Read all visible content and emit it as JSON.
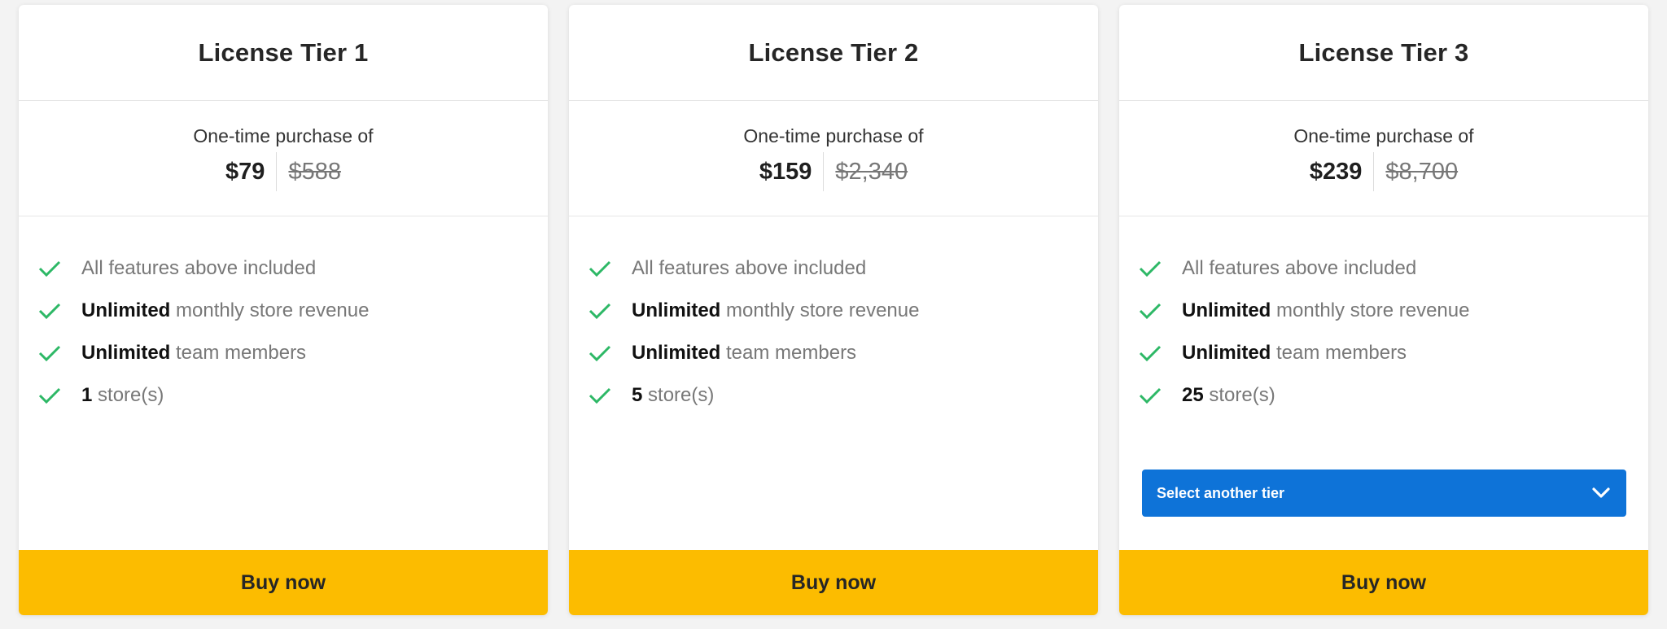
{
  "colors": {
    "accent_blue": "#0e73d8",
    "buy_yellow": "#fcbc00",
    "check_green": "#2db866"
  },
  "tiers": [
    {
      "title": "License Tier 1",
      "price_label": "One-time purchase of",
      "price_now": "$79",
      "price_old": "$588",
      "features": [
        {
          "bold": "",
          "text": "All features above included"
        },
        {
          "bold": "Unlimited",
          "text": " monthly store revenue"
        },
        {
          "bold": "Unlimited",
          "text": " team members"
        },
        {
          "bold": "1",
          "text": " store(s)"
        }
      ],
      "buy_label": "Buy now"
    },
    {
      "title": "License Tier 2",
      "price_label": "One-time purchase of",
      "price_now": "$159",
      "price_old": "$2,340",
      "features": [
        {
          "bold": "",
          "text": "All features above included"
        },
        {
          "bold": "Unlimited",
          "text": " monthly store revenue"
        },
        {
          "bold": "Unlimited",
          "text": " team members"
        },
        {
          "bold": "5",
          "text": " store(s)"
        }
      ],
      "buy_label": "Buy now"
    },
    {
      "title": "License Tier 3",
      "price_label": "One-time purchase of",
      "price_now": "$239",
      "price_old": "$8,700",
      "features": [
        {
          "bold": "",
          "text": "All features above included"
        },
        {
          "bold": "Unlimited",
          "text": " monthly store revenue"
        },
        {
          "bold": "Unlimited",
          "text": " team members"
        },
        {
          "bold": "25",
          "text": " store(s)"
        }
      ],
      "select_label": "Select another tier",
      "buy_label": "Buy now"
    }
  ]
}
